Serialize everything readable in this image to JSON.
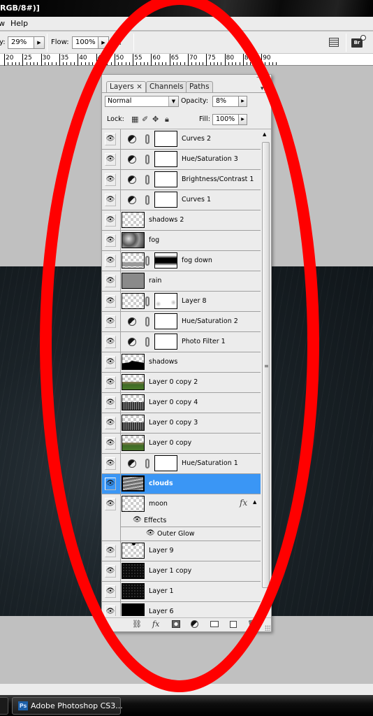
{
  "window": {
    "title_fragment": "RGB/8#)]"
  },
  "menubar": {
    "items": [
      "w",
      "Help"
    ]
  },
  "options_bar": {
    "opacity_label_fragment": "y:",
    "opacity_value": "29%",
    "flow_label": "Flow:",
    "flow_value": "100%",
    "airbrush_icon": "airbrush-icon",
    "palette_well_icon": "palette-well-icon",
    "bridge_icon": "bridge-icon",
    "bridge_label": "Br"
  },
  "ruler": {
    "ticks": [
      "20",
      "25",
      "30",
      "35",
      "40",
      "45",
      "50",
      "55",
      "60",
      "65",
      "70",
      "75",
      "80",
      "85",
      "90"
    ]
  },
  "layers_panel": {
    "tabs": [
      {
        "label": "Layers",
        "active": true,
        "closable": true
      },
      {
        "label": "Channels",
        "active": false
      },
      {
        "label": "Paths",
        "active": false
      }
    ],
    "close_glyph": "×",
    "blend_mode": "Normal",
    "opacity_label": "Opacity:",
    "opacity_value": "8%",
    "lock_label": "Lock:",
    "fill_label": "Fill:",
    "fill_value": "100%",
    "layers": [
      {
        "name": "Curves 2",
        "type": "adjustment",
        "visible": true
      },
      {
        "name": "Hue/Saturation 3",
        "type": "adjustment",
        "visible": true
      },
      {
        "name": "Brightness/Contrast 1",
        "type": "adjustment",
        "visible": true
      },
      {
        "name": "Curves 1",
        "type": "adjustment",
        "visible": true
      },
      {
        "name": "shadows 2",
        "type": "pixel",
        "thumb": "checker",
        "visible": true
      },
      {
        "name": "fog",
        "type": "pixel",
        "thumb": "fog",
        "visible": true
      },
      {
        "name": "fog down",
        "type": "masked",
        "thumb": "checker-fog",
        "mask": "band",
        "visible": true
      },
      {
        "name": "rain",
        "type": "pixel",
        "thumb": "gray",
        "visible": true
      },
      {
        "name": "Layer 8",
        "type": "masked",
        "thumb": "checker",
        "mask": "dots",
        "visible": true
      },
      {
        "name": "Hue/Saturation 2",
        "type": "adjustment",
        "visible": true
      },
      {
        "name": "Photo Filter 1",
        "type": "adjustment",
        "visible": true
      },
      {
        "name": "shadows",
        "type": "pixel",
        "thumb": "shadows",
        "visible": true
      },
      {
        "name": "Layer 0 copy 2",
        "type": "pixel",
        "thumb": "green",
        "visible": true
      },
      {
        "name": "Layer 0 copy 4",
        "type": "pixel",
        "thumb": "graytrees",
        "visible": true
      },
      {
        "name": "Layer 0 copy 3",
        "type": "pixel",
        "thumb": "graytrees",
        "visible": true
      },
      {
        "name": "Layer 0 copy",
        "type": "pixel",
        "thumb": "green",
        "visible": true
      },
      {
        "name": "Hue/Saturation 1",
        "type": "adjustment",
        "visible": true
      },
      {
        "name": "clouds",
        "type": "pixel",
        "thumb": "clouds",
        "visible": true,
        "selected": true
      },
      {
        "name": "moon",
        "type": "pixel",
        "thumb": "checker",
        "visible": true,
        "fx": true,
        "effects_label": "Effects",
        "effects": [
          "Outer Glow"
        ]
      },
      {
        "name": "Layer 9",
        "type": "pixel",
        "thumb": "checker",
        "visible": true
      },
      {
        "name": "Layer 1 copy",
        "type": "pixel",
        "thumb": "stars",
        "visible": true
      },
      {
        "name": "Layer 1",
        "type": "pixel",
        "thumb": "stars",
        "visible": true
      },
      {
        "name": "Layer 6",
        "type": "pixel",
        "thumb": "black",
        "visible": true
      }
    ],
    "footer_icons": [
      "link-layers-icon",
      "fx-icon",
      "add-mask-icon",
      "new-adjustment-icon",
      "new-group-icon",
      "new-layer-icon",
      "delete-layer-icon"
    ]
  },
  "taskbar": {
    "app_label": "Adobe Photoshop CS3...",
    "app_icon_text": "Ps"
  },
  "colors": {
    "selection": "#3a96f5",
    "annotation_red": "#ff0000",
    "panel_bg": "#ececec",
    "canvas_gray": "#c0c0c0"
  }
}
